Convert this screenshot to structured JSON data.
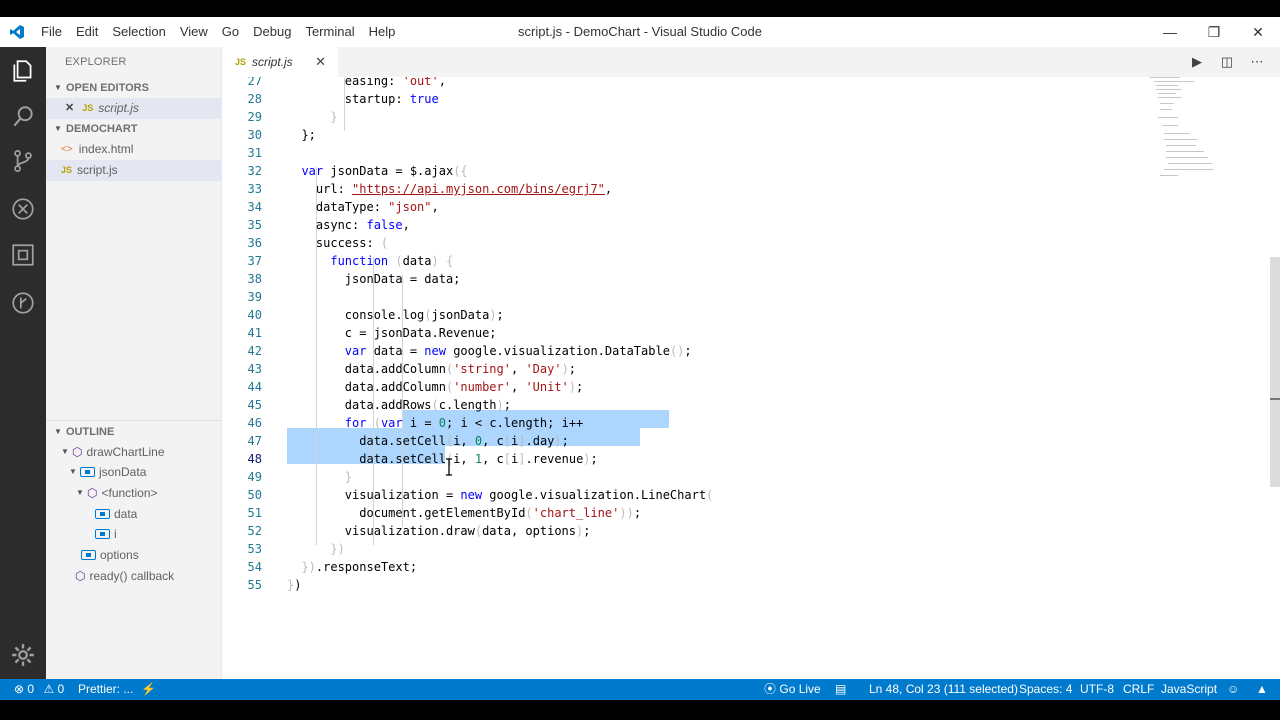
{
  "window": {
    "title": "script.js - DemoChart - Visual Studio Code"
  },
  "menu": [
    "File",
    "Edit",
    "Selection",
    "View",
    "Go",
    "Debug",
    "Terminal",
    "Help"
  ],
  "explorer": {
    "title": "EXPLORER",
    "open_editors": {
      "label": "OPEN EDITORS",
      "items": [
        "script.js"
      ]
    },
    "folder": {
      "label": "DEMOCHART",
      "files": [
        "index.html",
        "script.js"
      ]
    },
    "outline": {
      "label": "OUTLINE",
      "items": [
        "drawChartLine",
        "jsonData",
        "<function>",
        "data",
        "i",
        "options",
        "ready() callback"
      ]
    }
  },
  "tab": {
    "label": "script.js",
    "badge": "JS"
  },
  "editor": {
    "lines": [
      27,
      28,
      29,
      30,
      31,
      32,
      33,
      34,
      35,
      36,
      37,
      38,
      39,
      40,
      41,
      42,
      43,
      44,
      45,
      46,
      47,
      48,
      49,
      50,
      51,
      52,
      53,
      54,
      55
    ],
    "current_line": 48
  },
  "status": {
    "errors": "0",
    "warnings": "0",
    "prettier": "Prettier: ...",
    "golive": "Go Live",
    "position": "Ln 48, Col 23 (111 selected)",
    "spaces": "Spaces: 4",
    "encoding": "UTF-8",
    "eol": "CRLF",
    "language": "JavaScript"
  },
  "colors": {
    "statusbar": "#007acc",
    "activitybar": "#2c2c2c",
    "selection": "#add6ff",
    "keyword": "#0000ff",
    "string": "#a31515",
    "number": "#098658"
  }
}
